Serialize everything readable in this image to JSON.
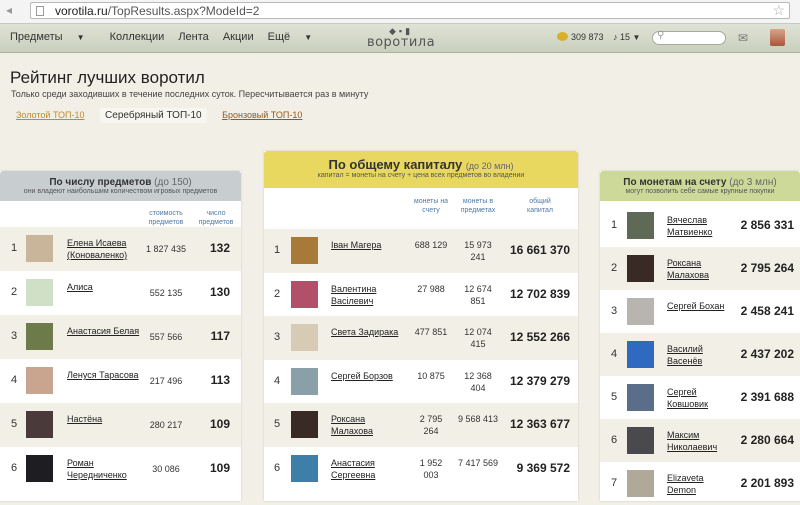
{
  "browser": {
    "url_host": "vorotila.ru",
    "url_path": "/TopResults.aspx?ModeId=2"
  },
  "nav": {
    "menu": [
      "Предметы",
      "Коллекции",
      "Лента",
      "Акции",
      "Ещё"
    ],
    "logo": "воротила",
    "coins": "309 873",
    "lamps": "15"
  },
  "page": {
    "title": "Рейтинг лучших воротил",
    "subtitle": "Только среди заходивших в течение последних суток. Пересчитывается раз в минуту",
    "tabs": [
      "Золотой ТОП-10",
      "Серебряный ТОП-10",
      "Бронзовый ТОП-10"
    ]
  },
  "left": {
    "title": "По числу предметов",
    "note": "(до 150)",
    "desc": "они владеют наибольшим количеством игровых предметов",
    "col1": "стоимость предметов",
    "col2": "число предметов",
    "rows": [
      {
        "rank": "1",
        "name": "Елена Исаева (Коноваленко)",
        "value": "1 827 435",
        "count": "132",
        "color": "#c8b59a"
      },
      {
        "rank": "2",
        "name": "Алиса",
        "value": "552 135",
        "count": "130",
        "color": "#cfe0c6"
      },
      {
        "rank": "3",
        "name": "Анастасия Белая",
        "value": "557 566",
        "count": "117",
        "color": "#6d7a4a"
      },
      {
        "rank": "4",
        "name": "Ленуся Тарасова",
        "value": "217 496",
        "count": "113",
        "color": "#c9a590"
      },
      {
        "rank": "5",
        "name": "Настёна",
        "value": "280 217",
        "count": "109",
        "color": "#4a3a3a"
      },
      {
        "rank": "6",
        "name": "Роман Чередниченко",
        "value": "30 086",
        "count": "109",
        "color": "#1e1e22"
      }
    ]
  },
  "center": {
    "title": "По общему капиталу",
    "note": "(до 20 млн)",
    "desc": "капитал = монеты на счету + цена всех предметов во владении",
    "col1": "монеты на счету",
    "col2": "монеты в предметах",
    "col3": "общий капитал",
    "rows": [
      {
        "rank": "1",
        "name": "Іван Магера",
        "coins": "688 129",
        "items": "15 973 241",
        "total": "16 661 370",
        "color": "#a87a3a"
      },
      {
        "rank": "2",
        "name": "Валентина Васілевич",
        "coins": "27 988",
        "items": "12 674 851",
        "total": "12 702 839",
        "color": "#b2506a"
      },
      {
        "rank": "3",
        "name": "Света Задирака",
        "coins": "477 851",
        "items": "12 074 415",
        "total": "12 552 266",
        "color": "#d7cbb6"
      },
      {
        "rank": "4",
        "name": "Сергей Борзов",
        "coins": "10 875",
        "items": "12 368 404",
        "total": "12 379 279",
        "color": "#8aa0a8"
      },
      {
        "rank": "5",
        "name": "Роксана Малахова",
        "coins": "2 795 264",
        "items": "9 568 413",
        "total": "12 363 677",
        "color": "#3a2a26"
      },
      {
        "rank": "6",
        "name": "Анастасия Сергеевна",
        "coins": "1 952 003",
        "items": "7 417 569",
        "total": "9 369 572",
        "color": "#3d7fa8"
      }
    ]
  },
  "right": {
    "title": "По монетам на счету",
    "note": "(до 3 млн)",
    "desc": "могут позволить себе самые крупные покупки",
    "rows": [
      {
        "rank": "1",
        "name": "Вячеслав Матвиенко",
        "total": "2 856 331",
        "color": "#5e6a56"
      },
      {
        "rank": "2",
        "name": "Роксана Малахова",
        "total": "2 795 264",
        "color": "#3a2a26"
      },
      {
        "rank": "3",
        "name": "Сергей Бохан",
        "total": "2 458 241",
        "color": "#b8b4b0"
      },
      {
        "rank": "4",
        "name": "Василий Васенёв",
        "total": "2 437 202",
        "color": "#2f6ac0"
      },
      {
        "rank": "5",
        "name": "Сергей Ковшовик",
        "total": "2 391 688",
        "color": "#5a6e8a"
      },
      {
        "rank": "6",
        "name": "Максим Николаевич",
        "total": "2 280 664",
        "color": "#4a4a4e"
      },
      {
        "rank": "7",
        "name": "Elizaveta Demon",
        "total": "2 201 893",
        "color": "#b0a898"
      }
    ]
  }
}
